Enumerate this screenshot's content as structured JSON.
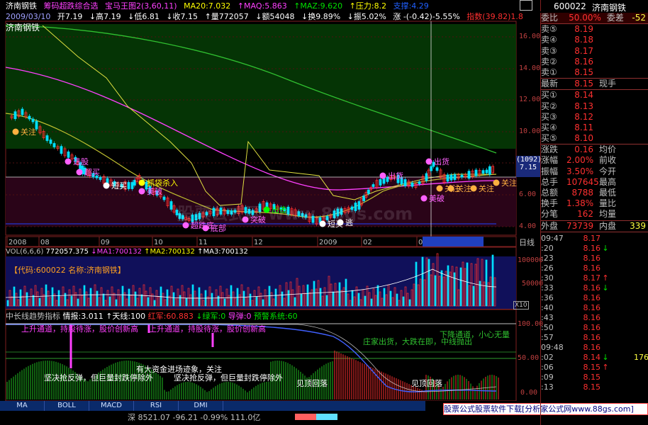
{
  "header": {
    "stock_name": "济南钢铁",
    "indicator_names": "筹码超跌综合选",
    "indicator2": "宝马王图2(3,60,11)",
    "ma20": "MA20:7.032",
    "maq": "↑MAQ:5.863",
    "maz": "↑MAZ:9.620",
    "pressure": "↑压力:8.2",
    "support": "支撑:4.29",
    "date": "2009/03/10",
    "open": "开7.19",
    "high": "↓高7.19",
    "low": "↓低6.81",
    "close": "↓收7.15",
    "volume": "↑量772057",
    "amount": "↓额54048",
    "turnover": "↓换9.89%",
    "amplitude": "↓振5.02%",
    "change": "涨 -(-0.42)-5.55%",
    "index_label": "指数(39.82)1.88%"
  },
  "main_chart": {
    "y_labels": [
      "16.00",
      "14.00",
      "12.00",
      "10.00",
      "8.00",
      "6.00",
      "4.00"
    ],
    "last_price_tag": "(1092)",
    "last_price": "7.15",
    "date_axis": [
      "2008",
      "08",
      "09",
      "10",
      "11",
      "12",
      "2009",
      "02",
      "03",
      "09/03/10,二"
    ],
    "right_tag": "日线",
    "annotations": [
      {
        "text": "关注",
        "color": "#ffb040"
      },
      {
        "text": "选股",
        "color": "#ff60ff"
      },
      {
        "text": "超买",
        "color": "#ff60ff"
      },
      {
        "text": "短买",
        "color": "#ffffff"
      },
      {
        "text": "抓袋杀入",
        "color": "#ffff00"
      },
      {
        "text": "美破",
        "color": "#ff60ff"
      },
      {
        "text": "超跌底",
        "color": "#ff60ff"
      },
      {
        "text": "底部",
        "color": "#ff60ff"
      },
      {
        "text": "突破",
        "color": "#ff60ff"
      },
      {
        "text": "出击",
        "color": "#00ff00"
      },
      {
        "text": "短买",
        "color": "#ffffff"
      },
      {
        "text": "逃",
        "color": "#ffffff"
      },
      {
        "text": "出货",
        "color": "#ff60ff"
      },
      {
        "text": "关注",
        "color": "#ffb040"
      },
      {
        "text": "关注",
        "color": "#ffb040"
      },
      {
        "text": "关注",
        "color": "#ffb040"
      },
      {
        "text": "关注",
        "color": "#ffb040"
      },
      {
        "text": "出货",
        "color": "#ff60ff"
      },
      {
        "text": "美破",
        "color": "#ff60ff"
      }
    ],
    "watermark": "股票公式网 www.88gs.com",
    "colors": {
      "green_zone": "#0a4a0a",
      "pink_band": "#2a0418",
      "ma_green": "#30c030",
      "ma_pink": "#ff40ff",
      "ma_yellow": "#e0e040",
      "line_blue": "#4060ff"
    }
  },
  "volume_panel": {
    "title": "VOL(6,6,6)",
    "vol": "772057.375",
    "ma1": "↓MA1:700132",
    "ma2": "↑MA2:700132",
    "ma3": "↑MA3:700132",
    "code_line": "【代码:600022 名称:济南钢铁】",
    "y_labels": [
      "100000",
      "50000"
    ],
    "unit": "X10"
  },
  "indicator_panel": {
    "name": "中长线趋势指标",
    "qingbao": "情报:3.011",
    "tianxian": "↑天线:100",
    "hongjun": "红军:60.883",
    "lvjun": "↓绿军:0",
    "daodan": "导弹:0",
    "yujing": "预警系统:60",
    "y_labels": [
      "100.00",
      "50.00",
      "0.00"
    ],
    "texts": [
      "上升通道，持股待涨，股价创新高",
      "上升通道，持股待涨，股价创新高",
      "下降通道，小心无量",
      "庄家出货，大跌在即，中线抛出",
      "有大资金进场迹象，关注",
      "坚决抢反弹，但巨量封跌停除外",
      "坚决抢反弹，但巨量封跌停除外",
      "见顶回落",
      "见顶回落"
    ]
  },
  "tabs": [
    "MA",
    "BOLL",
    "MACD",
    "RSI",
    "DMI"
  ],
  "status_bar": {
    "index_text": "深 8521.07 -96.21 -0.99% 111.0亿",
    "ad": "股票公式股票软件下载[分析家公式网www.88gs.com]"
  },
  "right_panel": {
    "code": "600022",
    "name": "济南钢铁",
    "webi_label": "委比",
    "webi": "50.00%",
    "wecha_label": "委差",
    "wecha": "-52",
    "sells": [
      {
        "label": "卖⑤",
        "price": "8.19",
        "qty": ""
      },
      {
        "label": "卖④",
        "price": "8.18",
        "qty": ""
      },
      {
        "label": "卖③",
        "price": "8.17",
        "qty": ""
      },
      {
        "label": "卖②",
        "price": "8.16",
        "qty": ""
      },
      {
        "label": "卖①",
        "price": "8.15",
        "qty": ""
      }
    ],
    "latest_label": "最新",
    "latest": "8.15",
    "hand_label": "现手",
    "buys": [
      {
        "label": "买①",
        "price": "8.14",
        "qty": ""
      },
      {
        "label": "买②",
        "price": "8.13",
        "qty": ""
      },
      {
        "label": "买③",
        "price": "8.12",
        "qty": ""
      },
      {
        "label": "买④",
        "price": "8.11",
        "qty": ""
      },
      {
        "label": "买⑤",
        "price": "8.10",
        "qty": ""
      }
    ],
    "stats": [
      {
        "l1": "涨跌",
        "v1": "0.16",
        "l2": "均价",
        "v2": ""
      },
      {
        "l1": "涨幅",
        "v1": "2.00%",
        "l2": "前收",
        "v2": ""
      },
      {
        "l1": "振幅",
        "v1": "3.50%",
        "l2": "今开",
        "v2": ""
      },
      {
        "l1": "总手",
        "v1": "107645",
        "l2": "最高",
        "v2": ""
      },
      {
        "l1": "总额",
        "v1": "8788",
        "l2": "最低",
        "v2": ""
      },
      {
        "l1": "换手",
        "v1": "1.38%",
        "l2": "量比",
        "v2": ""
      },
      {
        "l1": "分笔",
        "v1": "162",
        "l2": "均量",
        "v2": ""
      }
    ],
    "outer_label": "外盘",
    "outer": "73739",
    "inner_label": "内盘",
    "inner": "339",
    "ticks": [
      {
        "t": "09:47",
        "p": "8.17",
        "a": "",
        "n": ""
      },
      {
        "t": ":20",
        "p": "8.16",
        "a": "↓",
        "n": ""
      },
      {
        "t": ":23",
        "p": "8.16",
        "a": "",
        "n": ""
      },
      {
        "t": ":26",
        "p": "8.16",
        "a": "",
        "n": ""
      },
      {
        "t": ":30",
        "p": "8.17",
        "a": "↑",
        "n": ""
      },
      {
        "t": ":33",
        "p": "8.16",
        "a": "↓",
        "n": ""
      },
      {
        "t": ":36",
        "p": "8.16",
        "a": "",
        "n": ""
      },
      {
        "t": ":40",
        "p": "8.16",
        "a": "",
        "n": ""
      },
      {
        "t": ":43",
        "p": "8.16",
        "a": "",
        "n": ""
      },
      {
        "t": ":50",
        "p": "8.16",
        "a": "",
        "n": ""
      },
      {
        "t": ":57",
        "p": "8.16",
        "a": "",
        "n": ""
      },
      {
        "t": "09:48",
        "p": "8.16",
        "a": "",
        "n": ""
      },
      {
        "t": ":02",
        "p": "8.14",
        "a": "↓",
        "n": "176"
      },
      {
        "t": ":06",
        "p": "8.15",
        "a": "↑",
        "n": ""
      },
      {
        "t": ":09",
        "p": "8.15",
        "a": "",
        "n": ""
      },
      {
        "t": ":13",
        "p": "8.15",
        "a": "",
        "n": ""
      }
    ]
  }
}
